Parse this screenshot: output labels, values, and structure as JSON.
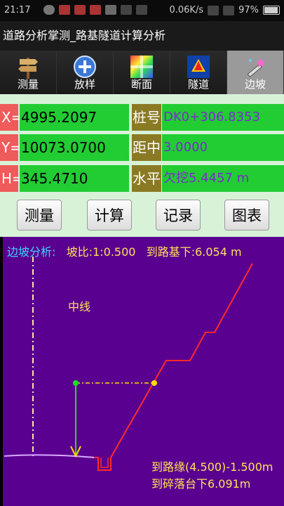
{
  "status_bar": {
    "time": "21:17",
    "speed": "0.06K/s",
    "battery": "97%",
    "battery_level": 0.97
  },
  "title": "道路分析掌测_路基隧道计算分析",
  "tabs": [
    {
      "label": "测量",
      "icon": "signpost-icon"
    },
    {
      "label": "放样",
      "icon": "plus-circle-icon"
    },
    {
      "label": "断面",
      "icon": "gradient-grid-icon"
    },
    {
      "label": "隧道",
      "icon": "tunnel-shell-icon"
    },
    {
      "label": "边坡",
      "icon": "magic-wand-icon",
      "active": true
    }
  ],
  "fields": {
    "x_label": "X=",
    "x_value": "4995.2097",
    "y_label": "Y=",
    "y_value": "10073.0700",
    "h_label": "H=",
    "h_value": "345.4710",
    "station_label": "桩号",
    "station_value": "DK0+306.8353",
    "offset_label": "距中",
    "offset_value": "3.0000",
    "level_label": "水平",
    "level_value": "欠挖5.4457 m"
  },
  "buttons": {
    "measure": "测量",
    "compute": "计算",
    "record": "记录",
    "chart": "图表"
  },
  "slope": {
    "header_lead": "边坡分析:",
    "ratio": "坡比:1:0.500",
    "to_subgrade": "到路基下:6.054 m",
    "centerline_label": "中线",
    "to_edge": "到路缘(4.500)-1.500m",
    "to_platform": "到碎落台下6.091m"
  },
  "colors": {
    "canvas_bg": "#5a0090",
    "profile": "#ff2a2a",
    "ground": "#d9a8ff",
    "measure_point": "#22dd22",
    "target_point": "#ffdd00",
    "text": "#ffe15a"
  }
}
